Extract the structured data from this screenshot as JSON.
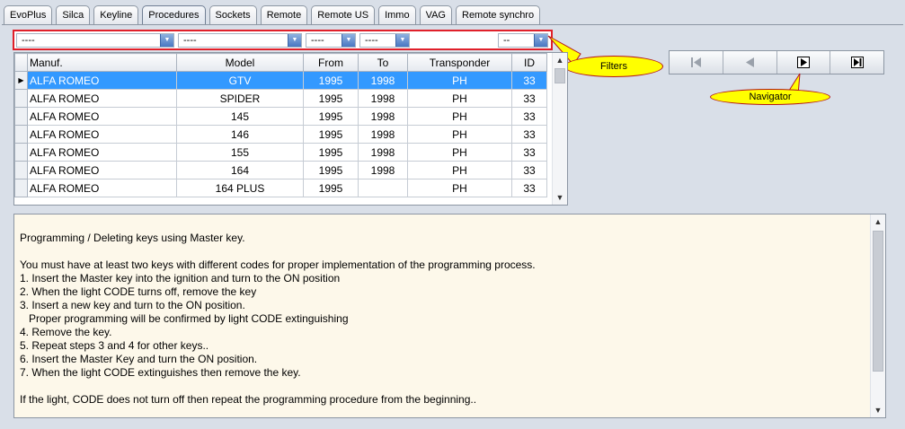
{
  "tabs": [
    {
      "label": "EvoPlus"
    },
    {
      "label": "Silca"
    },
    {
      "label": "Keyline"
    },
    {
      "label": "Procedures"
    },
    {
      "label": "Sockets"
    },
    {
      "label": "Remote"
    },
    {
      "label": "Remote US"
    },
    {
      "label": "Immo"
    },
    {
      "label": "VAG"
    },
    {
      "label": "Remote synchro"
    }
  ],
  "active_tab": "Procedures",
  "filters": {
    "manuf": "----",
    "model": "----",
    "from": "----",
    "to": "----",
    "transponder": "",
    "id": "--"
  },
  "callouts": {
    "filters": "Filters",
    "navigator": "Navigator"
  },
  "grid": {
    "columns": [
      "Manuf.",
      "Model",
      "From",
      "To",
      "Transponder",
      "ID"
    ],
    "rows": [
      {
        "manuf": "ALFA ROMEO",
        "model": "GTV",
        "from": "1995",
        "to": "1998",
        "transponder": "PH",
        "id": "33"
      },
      {
        "manuf": "ALFA ROMEO",
        "model": "SPIDER",
        "from": "1995",
        "to": "1998",
        "transponder": "PH",
        "id": "33"
      },
      {
        "manuf": "ALFA ROMEO",
        "model": "145",
        "from": "1995",
        "to": "1998",
        "transponder": "PH",
        "id": "33"
      },
      {
        "manuf": "ALFA ROMEO",
        "model": "146",
        "from": "1995",
        "to": "1998",
        "transponder": "PH",
        "id": "33"
      },
      {
        "manuf": "ALFA ROMEO",
        "model": "155",
        "from": "1995",
        "to": "1998",
        "transponder": "PH",
        "id": "33"
      },
      {
        "manuf": "ALFA ROMEO",
        "model": "164",
        "from": "1995",
        "to": "1998",
        "transponder": "PH",
        "id": "33"
      },
      {
        "manuf": "ALFA ROMEO",
        "model": "164 PLUS",
        "from": "1995",
        "to": "",
        "transponder": "PH",
        "id": "33"
      }
    ],
    "selected_row": 0
  },
  "navigator": {
    "buttons": [
      {
        "name": "first-record-button",
        "icon": "first-icon",
        "enabled": false
      },
      {
        "name": "prior-record-button",
        "icon": "prior-icon",
        "enabled": false
      },
      {
        "name": "next-record-button",
        "icon": "next-icon",
        "enabled": true
      },
      {
        "name": "last-record-button",
        "icon": "last-icon",
        "enabled": true
      }
    ]
  },
  "procedure_text": [
    "Programming / Deleting keys using Master key.",
    "",
    "You must have at least two keys with different codes for proper implementation of the programming process.",
    "1. Insert the Master key into the ignition and turn to the ON position",
    "2. When the light CODE turns off, remove the key",
    "3. Insert a new key and turn to the ON position.",
    "   Proper programming will be confirmed by light CODE extinguishing",
    "4. Remove the key.",
    "5. Repeat steps 3 and 4 for other keys..",
    "6. Insert the Master Key and turn the ON position.",
    "7. When the light CODE extinguishes then remove the key.",
    "",
    "If the light, CODE does not turn off then repeat the programming procedure from the beginning.."
  ],
  "colors": {
    "selection": "#3399ff",
    "filter_highlight": "#e0202a",
    "callout_fill": "#ffff00",
    "memo_background": "#fdf8ea"
  }
}
